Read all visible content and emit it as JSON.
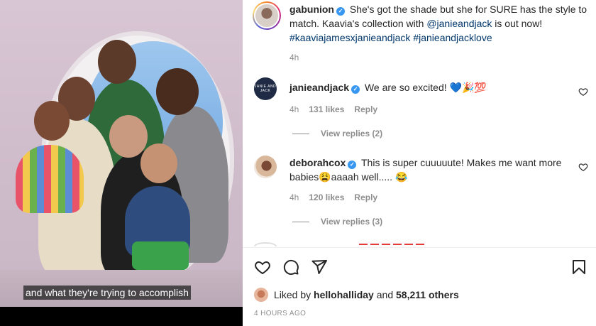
{
  "video": {
    "subtitle": "and what they're trying to accomplish"
  },
  "post": {
    "author": "gabunion",
    "caption_text": "She's got the shade but she for SURE has the style to match. Kaavia's collection with",
    "caption_mention": "@janieandjack",
    "caption_after": "is out now!",
    "hashtag1": "#kaaviajamesxjanieandjack",
    "hashtag2": "#janieandjacklove",
    "time": "4h"
  },
  "comments": [
    {
      "author": "janieandjack",
      "avatar_text": "JANIE AND JACK",
      "text": "We are so excited! 💙🎉💯",
      "time": "4h",
      "likes": "131 likes",
      "reply": "Reply",
      "view_replies": "View replies (2)"
    },
    {
      "author": "deborahcox",
      "text": "This is super cuuuuute! Makes me want more babies😩aaaah well..... 😂",
      "time": "4h",
      "likes": "120 likes",
      "reply": "Reply",
      "view_replies": "View replies (3)"
    }
  ],
  "liked_by": {
    "prefix": "Liked by",
    "user": "hellohalliday",
    "mid": "and",
    "others": "58,211 others"
  },
  "posted_ago": "4 HOURS AGO",
  "colors": {
    "link": "#00376b",
    "verified": "#3897f0",
    "muted": "#8e8e8e",
    "text": "#262626"
  },
  "icons": [
    "heart-icon",
    "comment-icon",
    "share-icon",
    "save-icon",
    "verified-icon"
  ]
}
